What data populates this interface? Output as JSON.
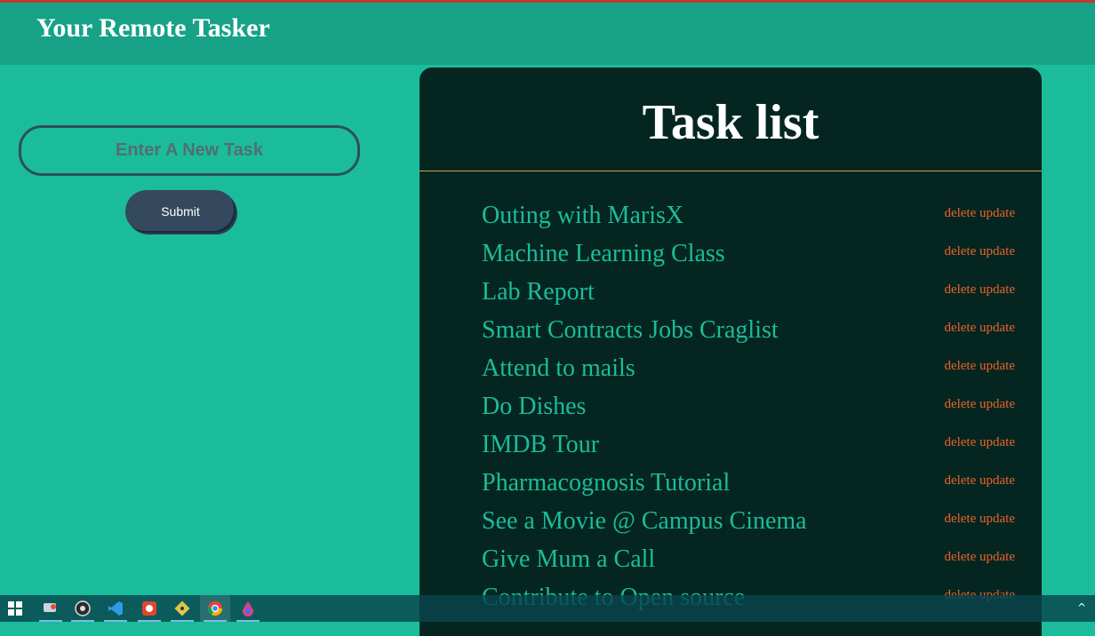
{
  "app": {
    "title": "Your Remote Tasker"
  },
  "form": {
    "placeholder": "Enter A New Task",
    "submit_label": "Submit"
  },
  "panel": {
    "title": "Task list"
  },
  "tasks": [
    {
      "name": "Outing with MarisX",
      "delete": "delete",
      "update": "update"
    },
    {
      "name": "Machine Learning Class",
      "delete": "delete",
      "update": "update"
    },
    {
      "name": "Lab Report",
      "delete": "delete",
      "update": "update"
    },
    {
      "name": "Smart Contracts Jobs Craglist",
      "delete": "delete",
      "update": "update"
    },
    {
      "name": "Attend to mails",
      "delete": "delete",
      "update": "update"
    },
    {
      "name": "Do Dishes",
      "delete": "delete",
      "update": "update"
    },
    {
      "name": "IMDB Tour",
      "delete": "delete",
      "update": "update"
    },
    {
      "name": "Pharmacognosis Tutorial",
      "delete": "delete",
      "update": "update"
    },
    {
      "name": "See a Movie @ Campus Cinema",
      "delete": "delete",
      "update": "update"
    },
    {
      "name": "Give Mum a Call",
      "delete": "delete",
      "update": "update"
    },
    {
      "name": "Contribute to Open source",
      "delete": "delete",
      "update": "update"
    }
  ],
  "taskbar": {
    "icons": [
      "windows-start-icon",
      "remote-desktop-icon",
      "obs-icon",
      "vscode-icon",
      "recorder-icon",
      "git-icon",
      "chrome-icon",
      "drop-icon"
    ],
    "tray_arrow": "^"
  },
  "colors": {
    "background": "#1bbc9b",
    "header": "#17a288",
    "panel": "#052620",
    "task_text": "#1bbc9b",
    "action_text": "#e8622c",
    "divider": "#c9a24b"
  }
}
